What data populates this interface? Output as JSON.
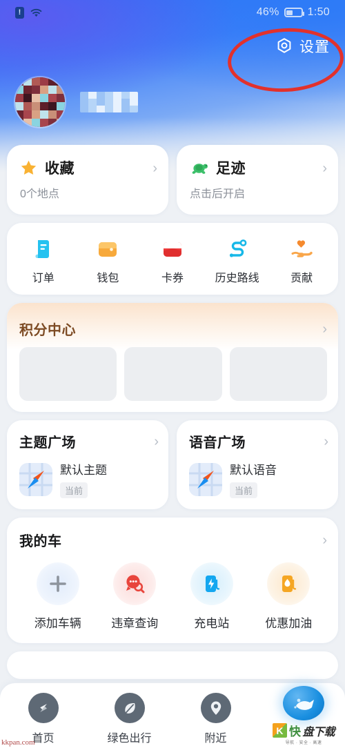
{
  "status_bar": {
    "alert_badge": "!",
    "wifi_icon": "wifi-icon",
    "battery_percent": "46%",
    "time": "1:50"
  },
  "header": {
    "settings_label": "设置",
    "settings_icon": "gear-icon",
    "annotation": "red-ellipse-highlight"
  },
  "profile": {
    "avatar_state": "mosaic-censored",
    "name_state": "mosaic-censored"
  },
  "quick_cards": [
    {
      "title": "收藏",
      "subtitle": "0个地点",
      "icon": "star-icon"
    },
    {
      "title": "足迹",
      "subtitle": "点击后开启",
      "icon": "turtle-icon"
    }
  ],
  "service_grid": [
    {
      "label": "订单",
      "icon": "order-document-icon"
    },
    {
      "label": "钱包",
      "icon": "wallet-icon"
    },
    {
      "label": "卡券",
      "icon": "coupon-card-icon"
    },
    {
      "label": "历史路线",
      "icon": "route-history-icon"
    },
    {
      "label": "贡献",
      "icon": "hand-heart-icon"
    }
  ],
  "points_center": {
    "title": "积分中心",
    "chevron": "chevron-right-icon",
    "placeholder_count": 3
  },
  "plaza": [
    {
      "title": "主题广场",
      "item_name": "默认主题",
      "badge": "当前",
      "thumb": "map-compass-icon"
    },
    {
      "title": "语音广场",
      "item_name": "默认语音",
      "badge": "当前",
      "thumb": "map-compass-icon"
    }
  ],
  "my_car": {
    "title": "我的车",
    "chevron": "chevron-right-icon",
    "items": [
      {
        "label": "添加车辆",
        "icon": "plus-icon",
        "color": "#8d949d"
      },
      {
        "label": "违章查询",
        "icon": "violation-search-icon",
        "color": "#e8453c"
      },
      {
        "label": "充电站",
        "icon": "charging-station-icon",
        "color": "#14a7f0"
      },
      {
        "label": "优惠加油",
        "icon": "fuel-pump-icon",
        "color": "#f5a623"
      }
    ]
  },
  "tab_bar": [
    {
      "label": "首页",
      "icon": "compass-icon"
    },
    {
      "label": "绿色出行",
      "icon": "leaf-icon"
    },
    {
      "label": "附近",
      "icon": "location-pin-icon"
    }
  ],
  "watermark": {
    "brand_k": "K",
    "brand_text_1": "快",
    "brand_text_2": "盘下载",
    "brand_sub": "导航 · 安全 · 高速",
    "url": "kkpan.com"
  },
  "colors": {
    "hero_blue": "#2b6df5",
    "annotation_red": "#e2312c",
    "page_bg": "#eef1f5",
    "points_accent": "#7c4a23"
  }
}
